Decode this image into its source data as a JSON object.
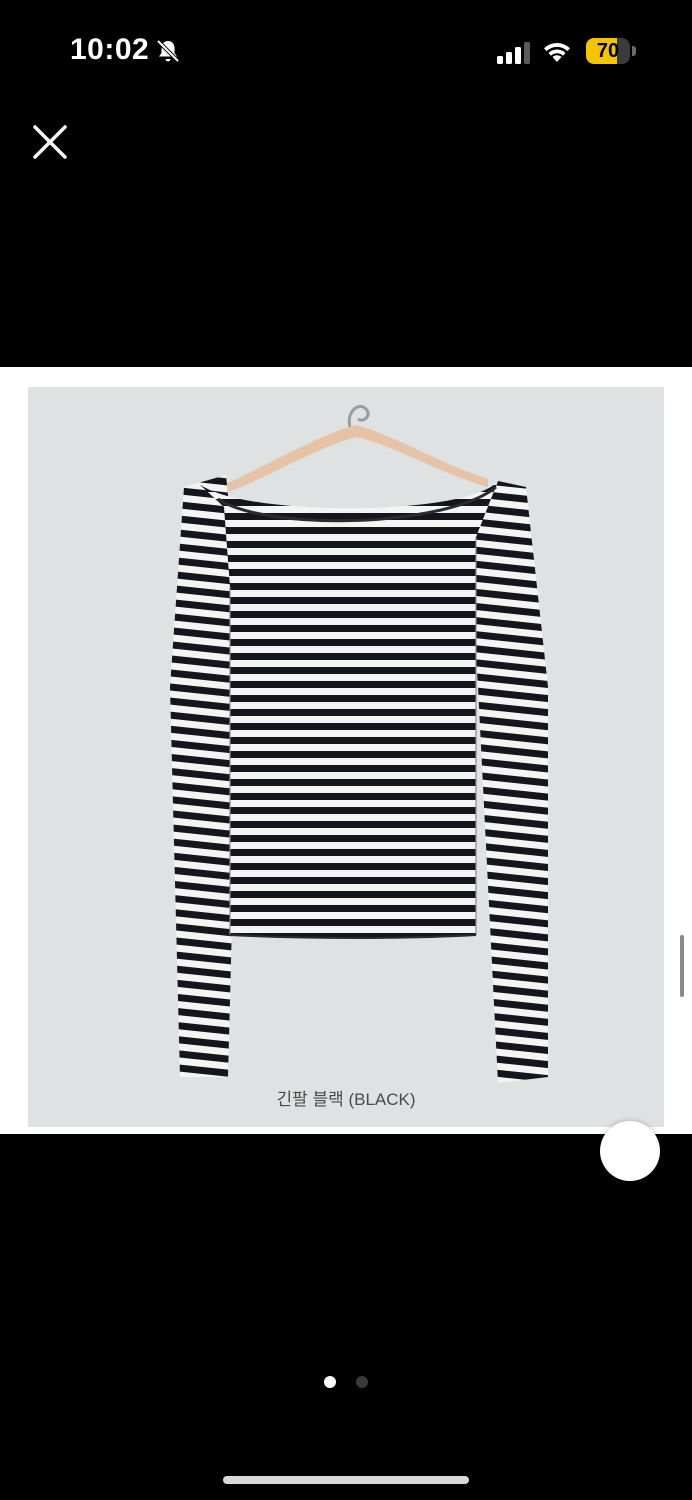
{
  "status_bar": {
    "time": "10:02",
    "battery_percent": "70",
    "battery_level": 0.7,
    "icons": [
      "bell-slash-icon",
      "cellular-signal-icon",
      "wifi-icon",
      "battery-icon"
    ]
  },
  "viewer": {
    "close_icon": "close-icon",
    "image": {
      "caption": "긴팔 블랙 (BLACK)",
      "description_icon": "striped-long-sleeve-top-on-hanger"
    },
    "pager": {
      "total": 2,
      "current": 1
    }
  },
  "colors": {
    "background": "#000000",
    "photo_background": "#dfe2e3",
    "stripe_dark": "#15161d",
    "stripe_light": "#f4f4f4",
    "battery_fill": "#f5c400"
  }
}
